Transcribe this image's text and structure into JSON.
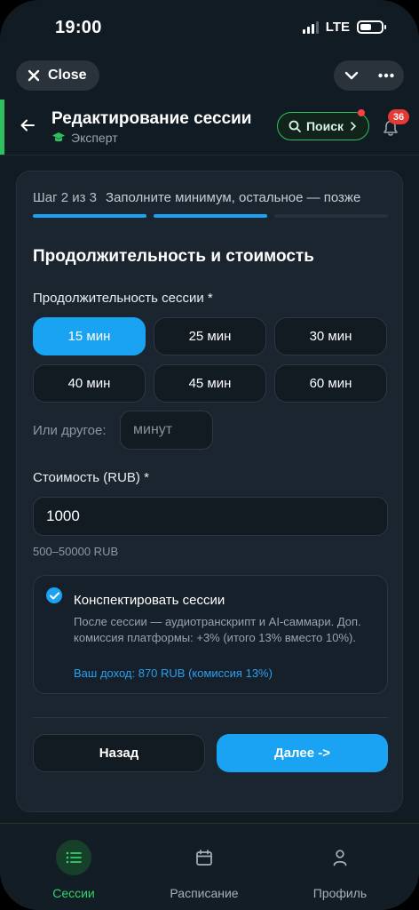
{
  "status_bar": {
    "time": "19:00",
    "network": "LTE"
  },
  "top_bar": {
    "close_label": "Close"
  },
  "header": {
    "title": "Редактирование сессии",
    "subtitle": "Эксперт",
    "search_label": "Поиск",
    "notification_count": "36"
  },
  "stepper": {
    "step_text": "Шаг 2 из 3",
    "hint": "Заполните минимум, остальное — позже",
    "progress_filled": 2,
    "progress_total": 3
  },
  "section_title": "Продолжительность и стоимость",
  "duration": {
    "label": "Продолжительность сессии *",
    "options": [
      "15 мин",
      "25 мин",
      "30 мин",
      "40 мин",
      "45 мин",
      "60 мин"
    ],
    "selected": "15 мин",
    "other_label": "Или другое:",
    "other_placeholder": "минут"
  },
  "price": {
    "label": "Стоимость (RUB) *",
    "value": "1000",
    "hint": "500–50000 RUB"
  },
  "notes": {
    "checked": true,
    "title": "Конспектировать сессии",
    "description": "После сессии — аудиотранскрипт и AI-саммари. Доп. комиссия платформы: +3% (итого 13% вместо 10%).",
    "income": "Ваш доход: 870 RUB (комиссия 13%)"
  },
  "actions": {
    "back_label": "Назад",
    "next_label": "Далее ->"
  },
  "bottom_nav": {
    "items": [
      {
        "label": "Сессии",
        "icon": "list-icon",
        "active": true
      },
      {
        "label": "Расписание",
        "icon": "calendar-icon",
        "active": false
      },
      {
        "label": "Профиль",
        "icon": "person-icon",
        "active": false
      }
    ]
  },
  "colors": {
    "accent_blue": "#1aa3f2",
    "accent_green": "#2fbf5e",
    "background": "#111b24",
    "card": "#1b252f"
  }
}
